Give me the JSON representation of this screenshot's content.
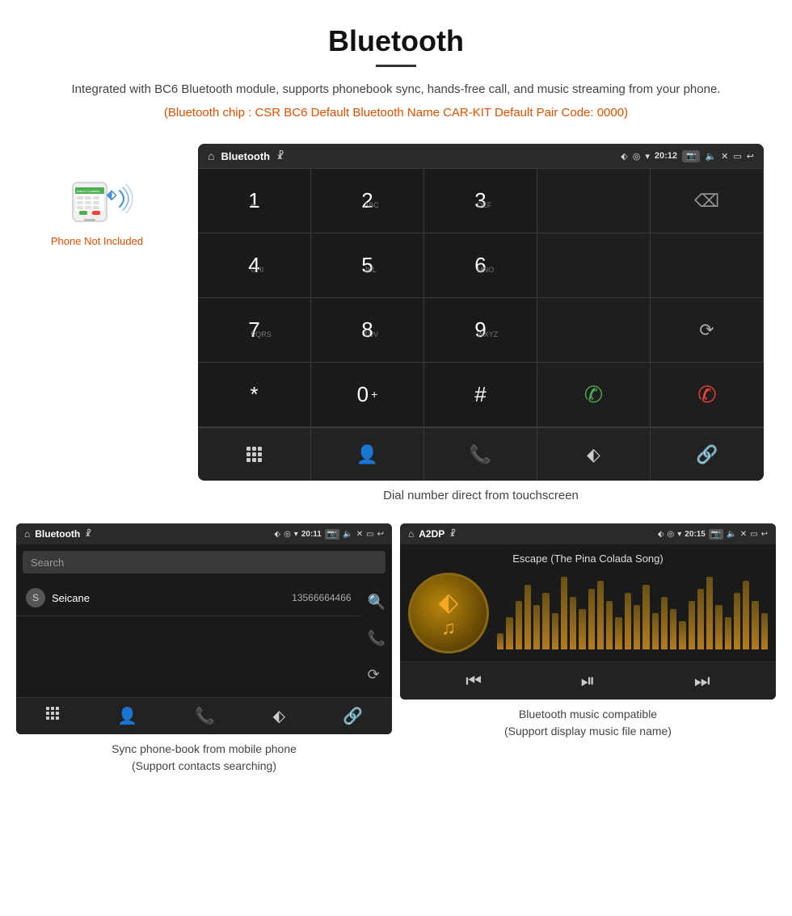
{
  "header": {
    "title": "Bluetooth",
    "description": "Integrated with BC6 Bluetooth module, supports phonebook sync, hands-free call, and music streaming from your phone.",
    "specs": "(Bluetooth chip : CSR BC6    Default Bluetooth Name CAR-KIT    Default Pair Code: 0000)"
  },
  "phone_label": "Phone Not Included",
  "dial_screen": {
    "app_name": "Bluetooth",
    "time": "20:12",
    "keys": [
      {
        "num": "1",
        "sub": ""
      },
      {
        "num": "2",
        "sub": "ABC"
      },
      {
        "num": "3",
        "sub": "DEF"
      },
      {
        "num": "",
        "sub": ""
      },
      {
        "num": "⌫",
        "sub": ""
      },
      {
        "num": "4",
        "sub": "GHI"
      },
      {
        "num": "5",
        "sub": "JKL"
      },
      {
        "num": "6",
        "sub": "MNO"
      },
      {
        "num": "",
        "sub": ""
      },
      {
        "num": "",
        "sub": ""
      },
      {
        "num": "7",
        "sub": "PQRS"
      },
      {
        "num": "8",
        "sub": "TUV"
      },
      {
        "num": "9",
        "sub": "WXYZ"
      },
      {
        "num": "",
        "sub": ""
      },
      {
        "num": "↻",
        "sub": ""
      },
      {
        "num": "*",
        "sub": ""
      },
      {
        "num": "0",
        "sub": "+"
      },
      {
        "num": "#",
        "sub": ""
      },
      {
        "num": "📞",
        "sub": ""
      },
      {
        "num": "📵",
        "sub": ""
      }
    ],
    "caption": "Dial number direct from touchscreen"
  },
  "phonebook_screen": {
    "app_name": "Bluetooth",
    "time": "20:11",
    "search_placeholder": "Search",
    "contact_name": "Seicane",
    "contact_initial": "S",
    "contact_number": "13566664466",
    "caption_line1": "Sync phone-book from mobile phone",
    "caption_line2": "(Support contacts searching)"
  },
  "music_screen": {
    "app_name": "A2DP",
    "time": "20:15",
    "song_title": "Escape (The Pina Colada Song)",
    "caption_line1": "Bluetooth music compatible",
    "caption_line2": "(Support display music file name)"
  },
  "eq_bars": [
    20,
    40,
    60,
    80,
    55,
    70,
    45,
    90,
    65,
    50,
    75,
    85,
    60,
    40,
    70,
    55,
    80,
    45,
    65,
    50,
    35,
    60,
    75,
    90,
    55,
    40,
    70,
    85,
    60,
    45
  ]
}
